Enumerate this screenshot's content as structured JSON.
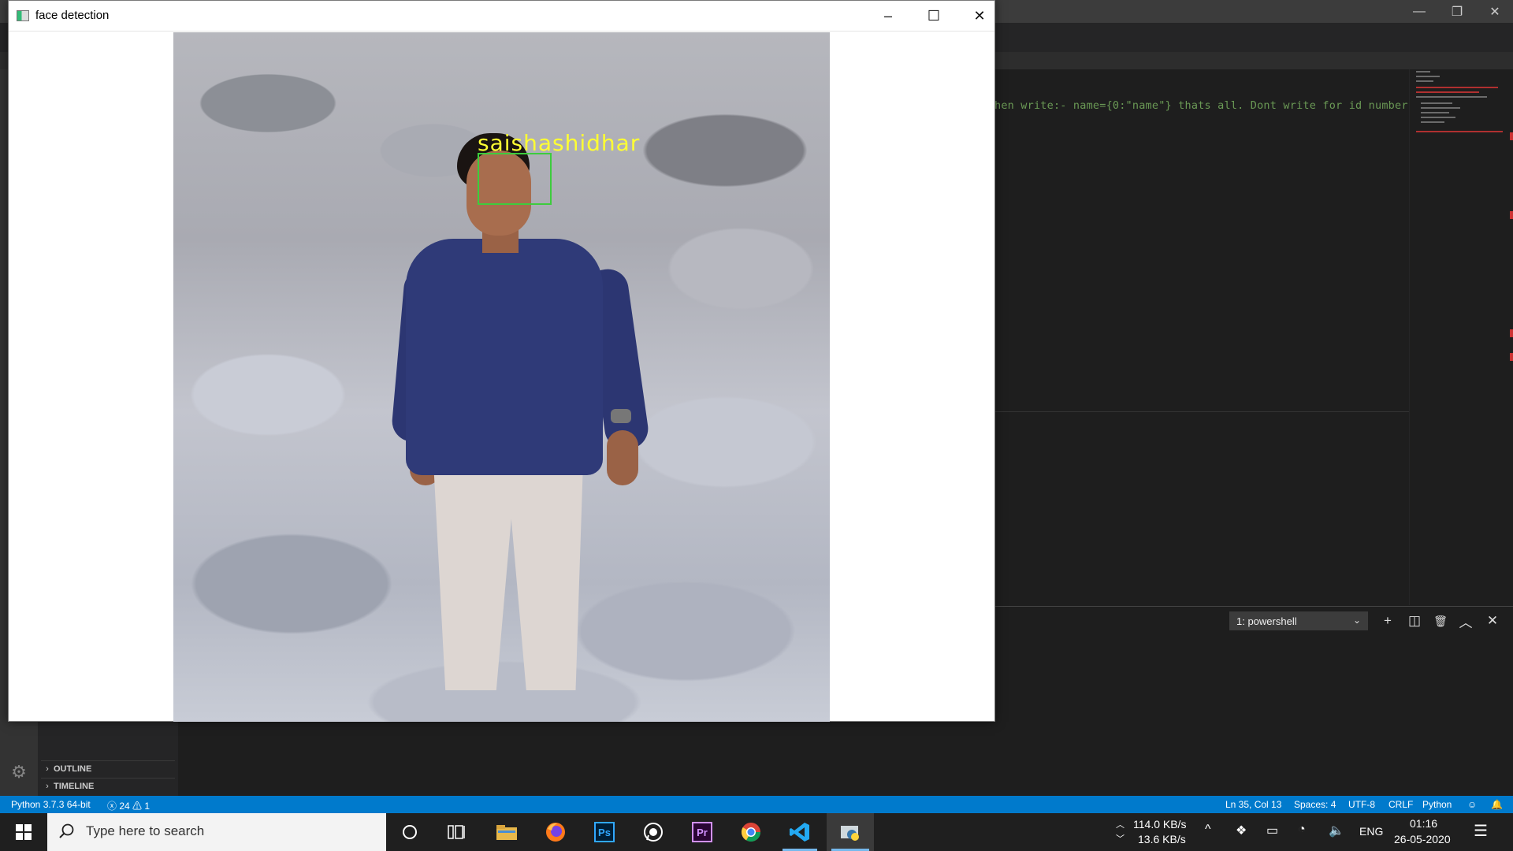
{
  "fd_window": {
    "title": "face detection",
    "minimize_icon": "–",
    "maximize_icon": "☐",
    "close_icon": "✕",
    "detection": {
      "label": "saishashidhar"
    }
  },
  "editor": {
    "line_text": "hen write:- name={0:\"name\"} thats all. Dont write for id number 1."
  },
  "vscode_window": {
    "minimize_icon": "—",
    "restore_icon": "❐",
    "close_icon": "✕"
  },
  "toolbar": {
    "run_icon": "▷",
    "split_icon": "◫",
    "more_icon": "⋯"
  },
  "terminal": {
    "selected": "1: powershell",
    "add_icon": "+",
    "split_icon": "◫",
    "trash_icon": "🗑",
    "maximize_icon": "︿",
    "close_icon": "✕"
  },
  "sidebar": {
    "outline": "OUTLINE",
    "timeline": "TIMELINE",
    "arrow": "›",
    "gear_icon": "⚙"
  },
  "statusbar": {
    "interpreter": "Python 3.7.3 64-bit",
    "problems": "ⓧ 24 ⚠ 1",
    "position": "Ln 35, Col 13",
    "spaces": "Spaces: 4",
    "encoding": "UTF-8",
    "eol": "CRLF",
    "language": "Python"
  },
  "taskbar": {
    "search_placeholder": "Type here to search",
    "network_up": "114.0 KB/s",
    "network_down": "13.6 KB/s",
    "language": "ENG",
    "time": "01:16",
    "date": "26-05-2020",
    "apps": [
      "cortana-icon",
      "task-view-icon",
      "file-explorer-icon",
      "firefox-icon",
      "photoshop-icon",
      "whatsapp-icon",
      "premiere-icon",
      "chrome-icon",
      "vscode-icon",
      "python-icon"
    ],
    "ps_label": "Ps",
    "pr_label": "Pr"
  },
  "colors": {
    "vscode_status": "#007acc",
    "face_box": "#3dcc3d",
    "face_label": "#ffff33"
  }
}
